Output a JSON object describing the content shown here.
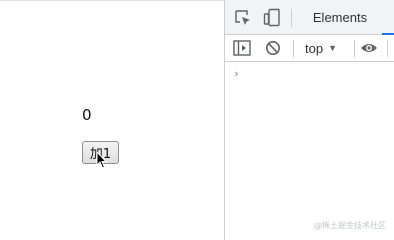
{
  "page": {
    "count_value": "0",
    "add_button_label": "加1"
  },
  "devtools": {
    "tabs": [
      {
        "label": "Elements",
        "active": true
      }
    ],
    "context_selector": {
      "value": "top"
    },
    "console_prompt": "›"
  },
  "watermark": "@稀土掘金技术社区",
  "colors": {
    "devtools_toolbar_bg": "#f1f3f4",
    "active_tab_underline": "#1a73e8",
    "prompt_blue": "#5e81c6"
  },
  "icons": [
    "inspect-element-icon",
    "device-toggle-icon",
    "sidebar-toggle-icon",
    "clear-console-icon",
    "eye-icon",
    "mouse-cursor-icon"
  ]
}
